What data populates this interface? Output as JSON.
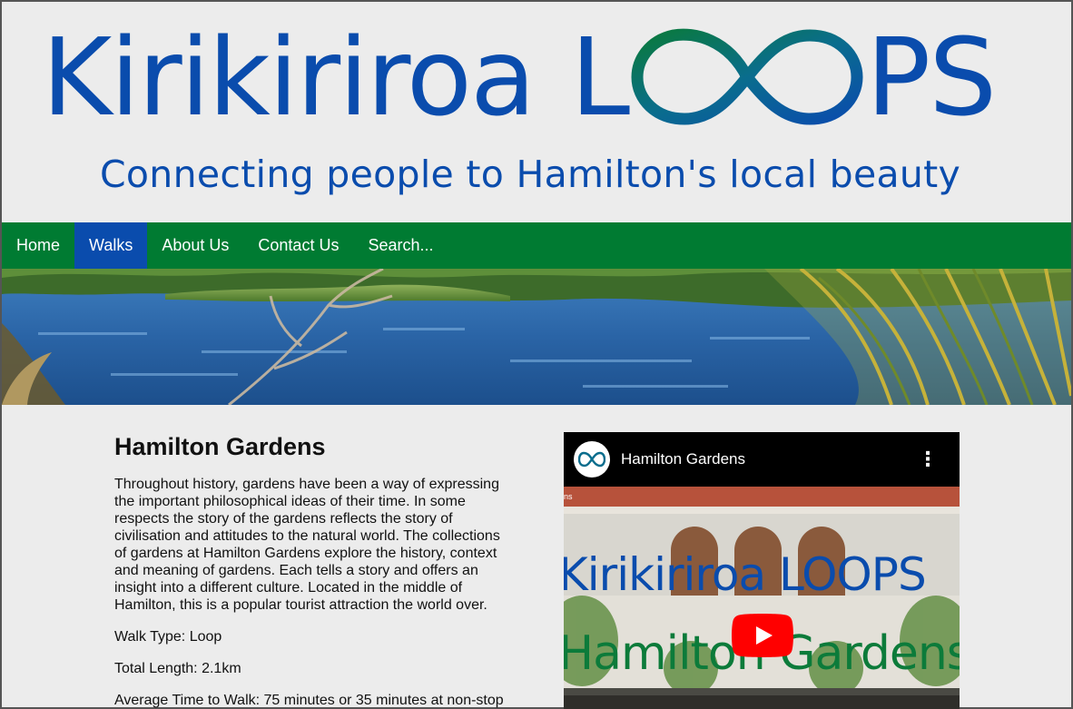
{
  "brand": {
    "logo_word": "Kirikiriroa",
    "logo_l": "L",
    "logo_ps": "PS",
    "logo_alt": "Kirikiriroa LOOPS",
    "tagline": "Connecting people to Hamilton's local beauty",
    "blue": "#0a4cad",
    "green": "#007b32"
  },
  "nav": {
    "items": [
      {
        "label": "Home"
      },
      {
        "label": "Walks",
        "active": true
      },
      {
        "label": "About Us"
      },
      {
        "label": "Contact Us"
      },
      {
        "label": "Search..."
      }
    ]
  },
  "article": {
    "title": "Hamilton Gardens",
    "intro": "Throughout history, gardens have been a way of expressing the important philosophical ideas of their time. In some respects the story of the gardens reflects the story of civilisation and attitudes to the natural world. The collections of gardens at Hamilton Gardens explore the history, context and meaning of gardens. Each tells a story and offers an insight into a different culture. Located in the middle of Hamilton, this is a popular tourist attraction the world over.",
    "walk_type": "Walk Type: Loop",
    "total_length": "Total Length: 2.1km",
    "average_time": "Average Time to Walk: 75 minutes or 35 minutes at non-stop"
  },
  "video": {
    "title": "Hamilton Gardens",
    "overlay_logo": "Kirikiriroa LOOPS",
    "overlay_sub": "Hamilton Gardens",
    "channel_fragment": "ns",
    "icons": {
      "menu": "kebab-menu-icon",
      "play": "youtube-play-icon",
      "avatar": "loops-logo-icon"
    }
  }
}
